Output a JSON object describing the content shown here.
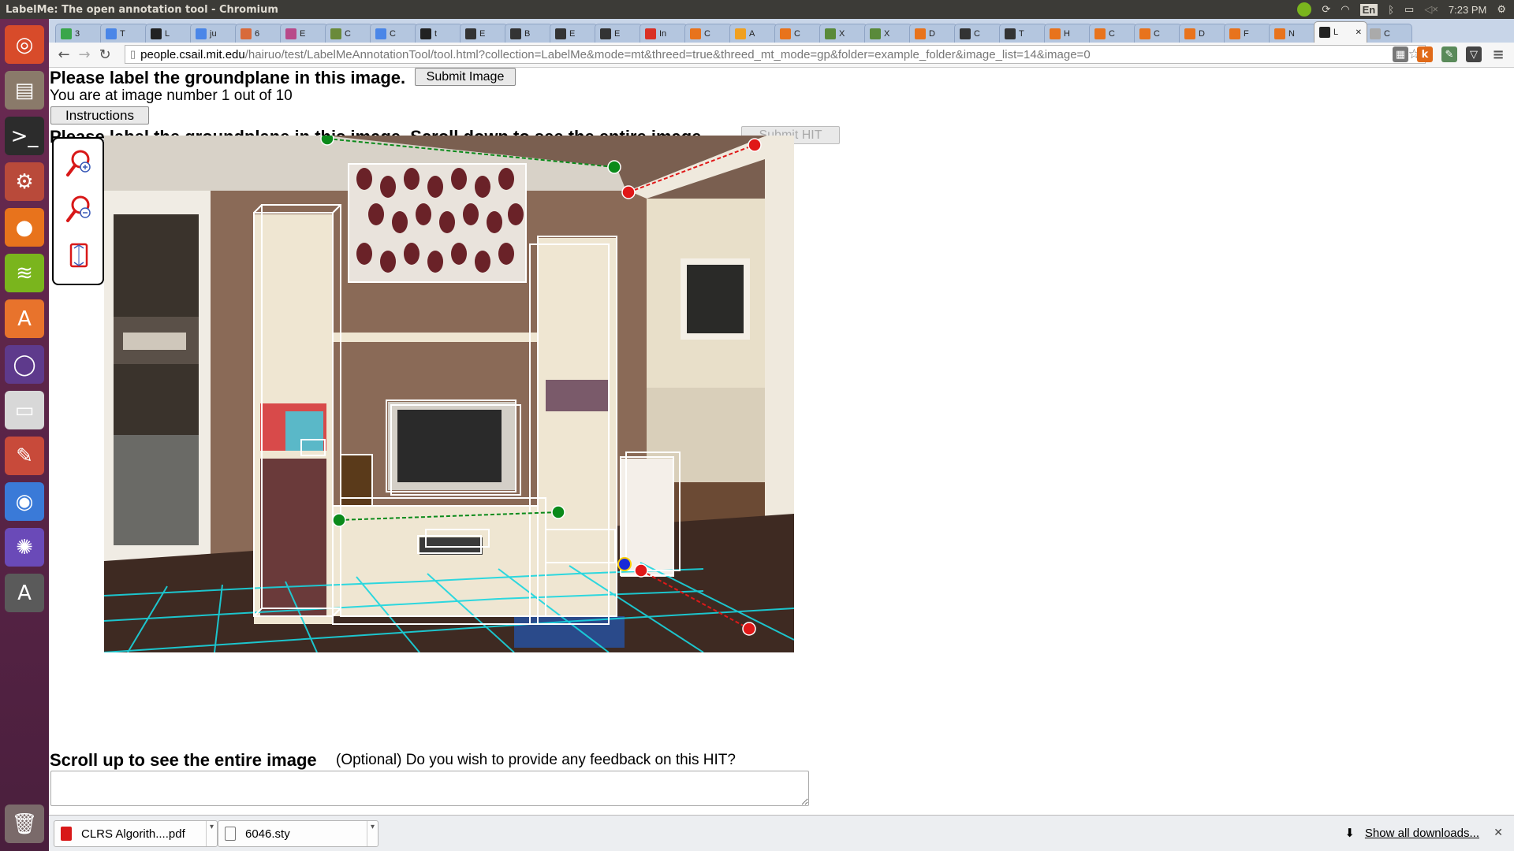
{
  "window": {
    "title": "LabelMe: The open annotation tool - Chromium"
  },
  "indicators": {
    "keyboard": "En",
    "time": "7:23 PM"
  },
  "launcher": [
    {
      "name": "ubuntu-dash",
      "glyph": "◎",
      "color": "#d84b2a"
    },
    {
      "name": "files",
      "glyph": "▤",
      "color": "#8a7a6a"
    },
    {
      "name": "terminal",
      "glyph": ">_",
      "color": "#2c2c2c"
    },
    {
      "name": "system-settings",
      "glyph": "⚙",
      "color": "#b94a3a"
    },
    {
      "name": "firefox",
      "glyph": "●",
      "color": "#e8731c"
    },
    {
      "name": "spotify",
      "glyph": "≋",
      "color": "#7ab51d"
    },
    {
      "name": "software-center",
      "glyph": "A",
      "color": "#e8732c"
    },
    {
      "name": "unity-tweak",
      "glyph": "◯",
      "color": "#5e3a8c"
    },
    {
      "name": "drive",
      "glyph": "▭",
      "color": "#d8d8d8"
    },
    {
      "name": "text-editor",
      "glyph": "✎",
      "color": "#c84a3a"
    },
    {
      "name": "chromium",
      "glyph": "◉",
      "color": "#3a7ad8"
    },
    {
      "name": "shotwell",
      "glyph": "✺",
      "color": "#6a4ab8"
    },
    {
      "name": "software-updater",
      "glyph": "A",
      "color": "#5a5a5a"
    },
    {
      "name": "trash",
      "glyph": "🗑",
      "color": "#7a6a6a"
    }
  ],
  "tabs": [
    {
      "label": "3",
      "color": "#3aa64a"
    },
    {
      "label": "T",
      "color": "#4a86e8"
    },
    {
      "label": "L",
      "color": "#222222"
    },
    {
      "label": "ju",
      "color": "#4a86e8"
    },
    {
      "label": "6",
      "color": "#d86a3a"
    },
    {
      "label": "E",
      "color": "#b84a8a"
    },
    {
      "label": "C",
      "color": "#6a8a3a"
    },
    {
      "label": "C",
      "color": "#4a86e8"
    },
    {
      "label": "t",
      "color": "#222222"
    },
    {
      "label": "E",
      "color": "#333333"
    },
    {
      "label": "B",
      "color": "#333333"
    },
    {
      "label": "E",
      "color": "#333333"
    },
    {
      "label": "E",
      "color": "#333333"
    },
    {
      "label": "In",
      "color": "#d93025"
    },
    {
      "label": "C",
      "color": "#e8731c"
    },
    {
      "label": "A",
      "color": "#f0a020"
    },
    {
      "label": "C",
      "color": "#e8731c"
    },
    {
      "label": "X",
      "color": "#5a8a3a"
    },
    {
      "label": "X",
      "color": "#5a8a3a"
    },
    {
      "label": "D",
      "color": "#e8731c"
    },
    {
      "label": "C",
      "color": "#333333"
    },
    {
      "label": "T",
      "color": "#333333"
    },
    {
      "label": "H",
      "color": "#e8731c"
    },
    {
      "label": "C",
      "color": "#e8731c"
    },
    {
      "label": "C",
      "color": "#e8731c"
    },
    {
      "label": "D",
      "color": "#e8731c"
    },
    {
      "label": "F",
      "color": "#e8731c"
    },
    {
      "label": "N",
      "color": "#e8731c"
    },
    {
      "label": "L",
      "color": "#222222",
      "active": true
    },
    {
      "label": "C",
      "color": "#aaaaaa"
    }
  ],
  "address": {
    "host": "people.csail.mit.edu",
    "path": "/hairuo/test/LabelMeAnnotationTool/tool.html?collection=LabelMe&mode=mt&threed=true&threed_mt_mode=gp&folder=example_folder&image_list=14&image=0"
  },
  "page": {
    "heading": "Please label the groundplane in this image.",
    "submit_image": "Submit Image",
    "image_counter": "You are at image number 1 out of 10",
    "instructions": "Instructions",
    "heading2": "Please label the groundplane in this image. Scroll down to see the entire image.",
    "submit_hit": "Submit HIT",
    "scroll_up": "Scroll up to see the entire image",
    "feedback_prompt": "(Optional) Do you wish to provide any feedback on this HIT?",
    "feedback_value": ""
  },
  "tools": [
    {
      "name": "zoom-in-icon"
    },
    {
      "name": "zoom-out-icon"
    },
    {
      "name": "fit-to-screen-icon"
    }
  ],
  "colors": {
    "ground_line": "#0a8a1a",
    "wall_line": "#e01818",
    "grid": "#19d6e0",
    "box": "#ffffff"
  },
  "downloads": {
    "items": [
      {
        "label": "CLRS Algorith....pdf",
        "icon": "pdf-icon"
      },
      {
        "label": "6046.sty",
        "icon": "file-icon"
      }
    ],
    "show_all": "Show all downloads..."
  }
}
